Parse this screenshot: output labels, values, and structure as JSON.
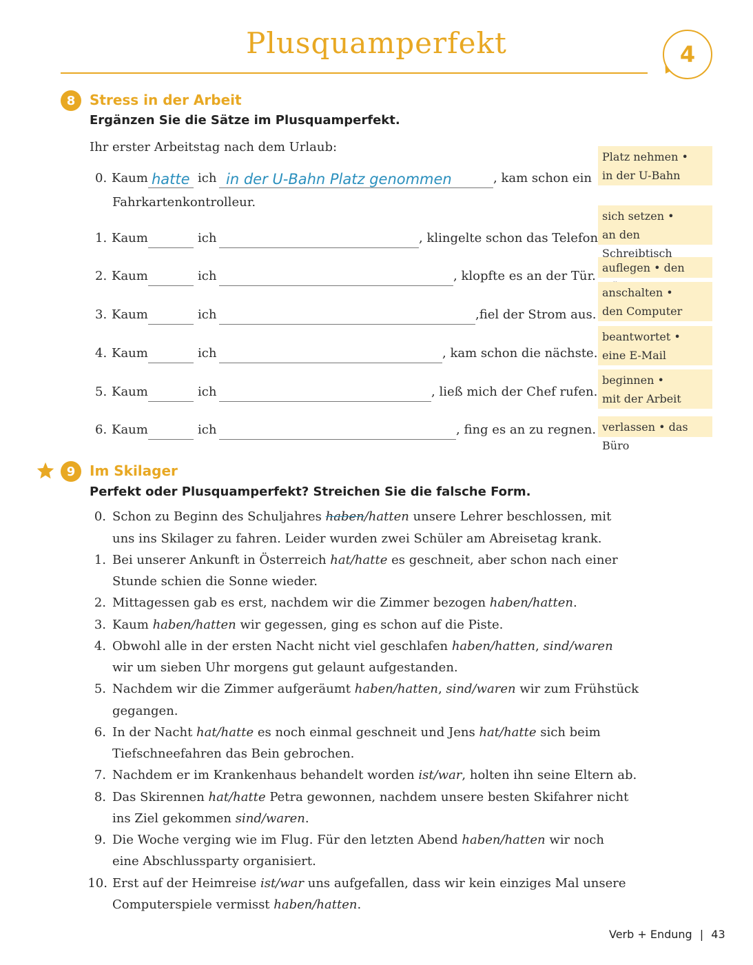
{
  "header": {
    "title": "Plusquamperfekt",
    "chapter": "4"
  },
  "ex8": {
    "number": "8",
    "title": "Stress in der Arbeit",
    "instruction": "Ergänzen Sie die Sätze im Plusquamperfekt.",
    "intro": "Ihr erster Arbeitstag nach dem Urlaub:",
    "kaum": "Kaum",
    "ich": "ich",
    "example": {
      "num": "0.",
      "aux": "hatte",
      "phrase": "in der U-Bahn Platz genommen",
      "ending": ", kam schon ein",
      "cont": "Fahrkartenkontrolleur."
    },
    "items": [
      {
        "num": "1.",
        "ending": ", klingelte schon das Telefon."
      },
      {
        "num": "2.",
        "ending": ", klopfte es an der Tür."
      },
      {
        "num": "3.",
        "ending": ",fiel der Strom aus."
      },
      {
        "num": "4.",
        "ending": ", kam schon die nächste."
      },
      {
        "num": "5.",
        "ending": ", ließ mich der Chef rufen."
      },
      {
        "num": "6.",
        "ending": ", fing es an zu regnen."
      }
    ],
    "hints": [
      {
        "l1": "Platz nehmen •",
        "l2": "in der U-Bahn"
      },
      {
        "l1": "sich setzen •",
        "l2": "an den Schreibtisch"
      },
      {
        "l1": "auflegen • den Hörer",
        "l2": ""
      },
      {
        "l1": "anschalten •",
        "l2": "den Computer"
      },
      {
        "l1": "beantwortet •",
        "l2": "eine E-Mail"
      },
      {
        "l1": "beginnen •",
        "l2": "mit der Arbeit"
      },
      {
        "l1": "verlassen • das Büro",
        "l2": ""
      }
    ]
  },
  "ex9": {
    "number": "9",
    "title": "Im Skilager",
    "instruction": "Perfekt oder Plusquamperfekt? Streichen Sie die falsche Form.",
    "s0": {
      "num": "0.",
      "a": "Schon zu Beginn des Schuljahres ",
      "strike": "haben",
      "b": "/hatten",
      "c": " unsere Lehrer beschlossen, mit",
      "l2": "uns ins Skilager zu fahren. Leider wurden zwei Schüler am Abreisetag krank."
    },
    "s1": {
      "num": "1.",
      "a": "Bei unserer Ankunft in Österreich ",
      "opt": "hat/hatte",
      "c": " es geschneit, aber schon nach einer",
      "l2": "Stunde schien die Sonne wieder."
    },
    "s2": {
      "num": "2.",
      "a": "Mittagessen gab es erst, nachdem wir die Zimmer bezogen ",
      "opt": "haben/hatten",
      "c": "."
    },
    "s3": {
      "num": "3.",
      "a": "Kaum ",
      "opt": "haben/hatten",
      "c": " wir gegessen, ging es schon auf die Piste."
    },
    "s4": {
      "num": "4.",
      "a": "Obwohl alle in der ersten Nacht nicht viel geschlafen ",
      "opt": "haben/hatten",
      "sep": ", ",
      "opt2": "sind/waren",
      "l2": "wir um sieben Uhr morgens gut gelaunt aufgestanden."
    },
    "s5": {
      "num": "5.",
      "a": "Nachdem wir die Zimmer aufgeräumt ",
      "opt": "haben/hatten",
      "sep": ", ",
      "opt2": "sind/waren",
      "c": " wir zum Frühstück",
      "l2": "gegangen."
    },
    "s6": {
      "num": "6.",
      "a": "In der Nacht ",
      "opt": "hat/hatte",
      "b": " es noch einmal geschneit und Jens ",
      "opt2": "hat/hatte",
      "c": " sich beim",
      "l2": "Tiefschneefahren das Bein gebrochen."
    },
    "s7": {
      "num": "7.",
      "a": "Nachdem er im Krankenhaus behandelt worden ",
      "opt": "ist/war",
      "c": ", holten ihn seine Eltern ab."
    },
    "s8": {
      "num": "8.",
      "a": "Das Skirennen ",
      "opt": "hat/hatte",
      "c": " Petra gewonnen, nachdem unsere besten Skifahrer nicht",
      "l2a": "ins Ziel gekommen ",
      "opt2": "sind/waren",
      "l2b": "."
    },
    "s9": {
      "num": "9.",
      "a": "Die Woche verging wie im Flug. Für den letzten Abend ",
      "opt": "haben/hatten",
      "c": " wir noch",
      "l2": "eine Abschlussparty organisiert."
    },
    "s10": {
      "num": "10.",
      "a": "Erst auf der Heimreise ",
      "opt": "ist/war",
      "c": " uns aufgefallen, dass wir kein einziges Mal unsere",
      "l2a": "Computerspiele vermisst ",
      "opt2": "haben/hatten",
      "l2b": "."
    }
  },
  "footer": {
    "section": "Verb + Endung",
    "sep": "|",
    "page": "43"
  },
  "colors": {
    "accent": "#e8a823",
    "hint_bg": "#fdf0c8",
    "handwriting": "#2a8fbd"
  }
}
